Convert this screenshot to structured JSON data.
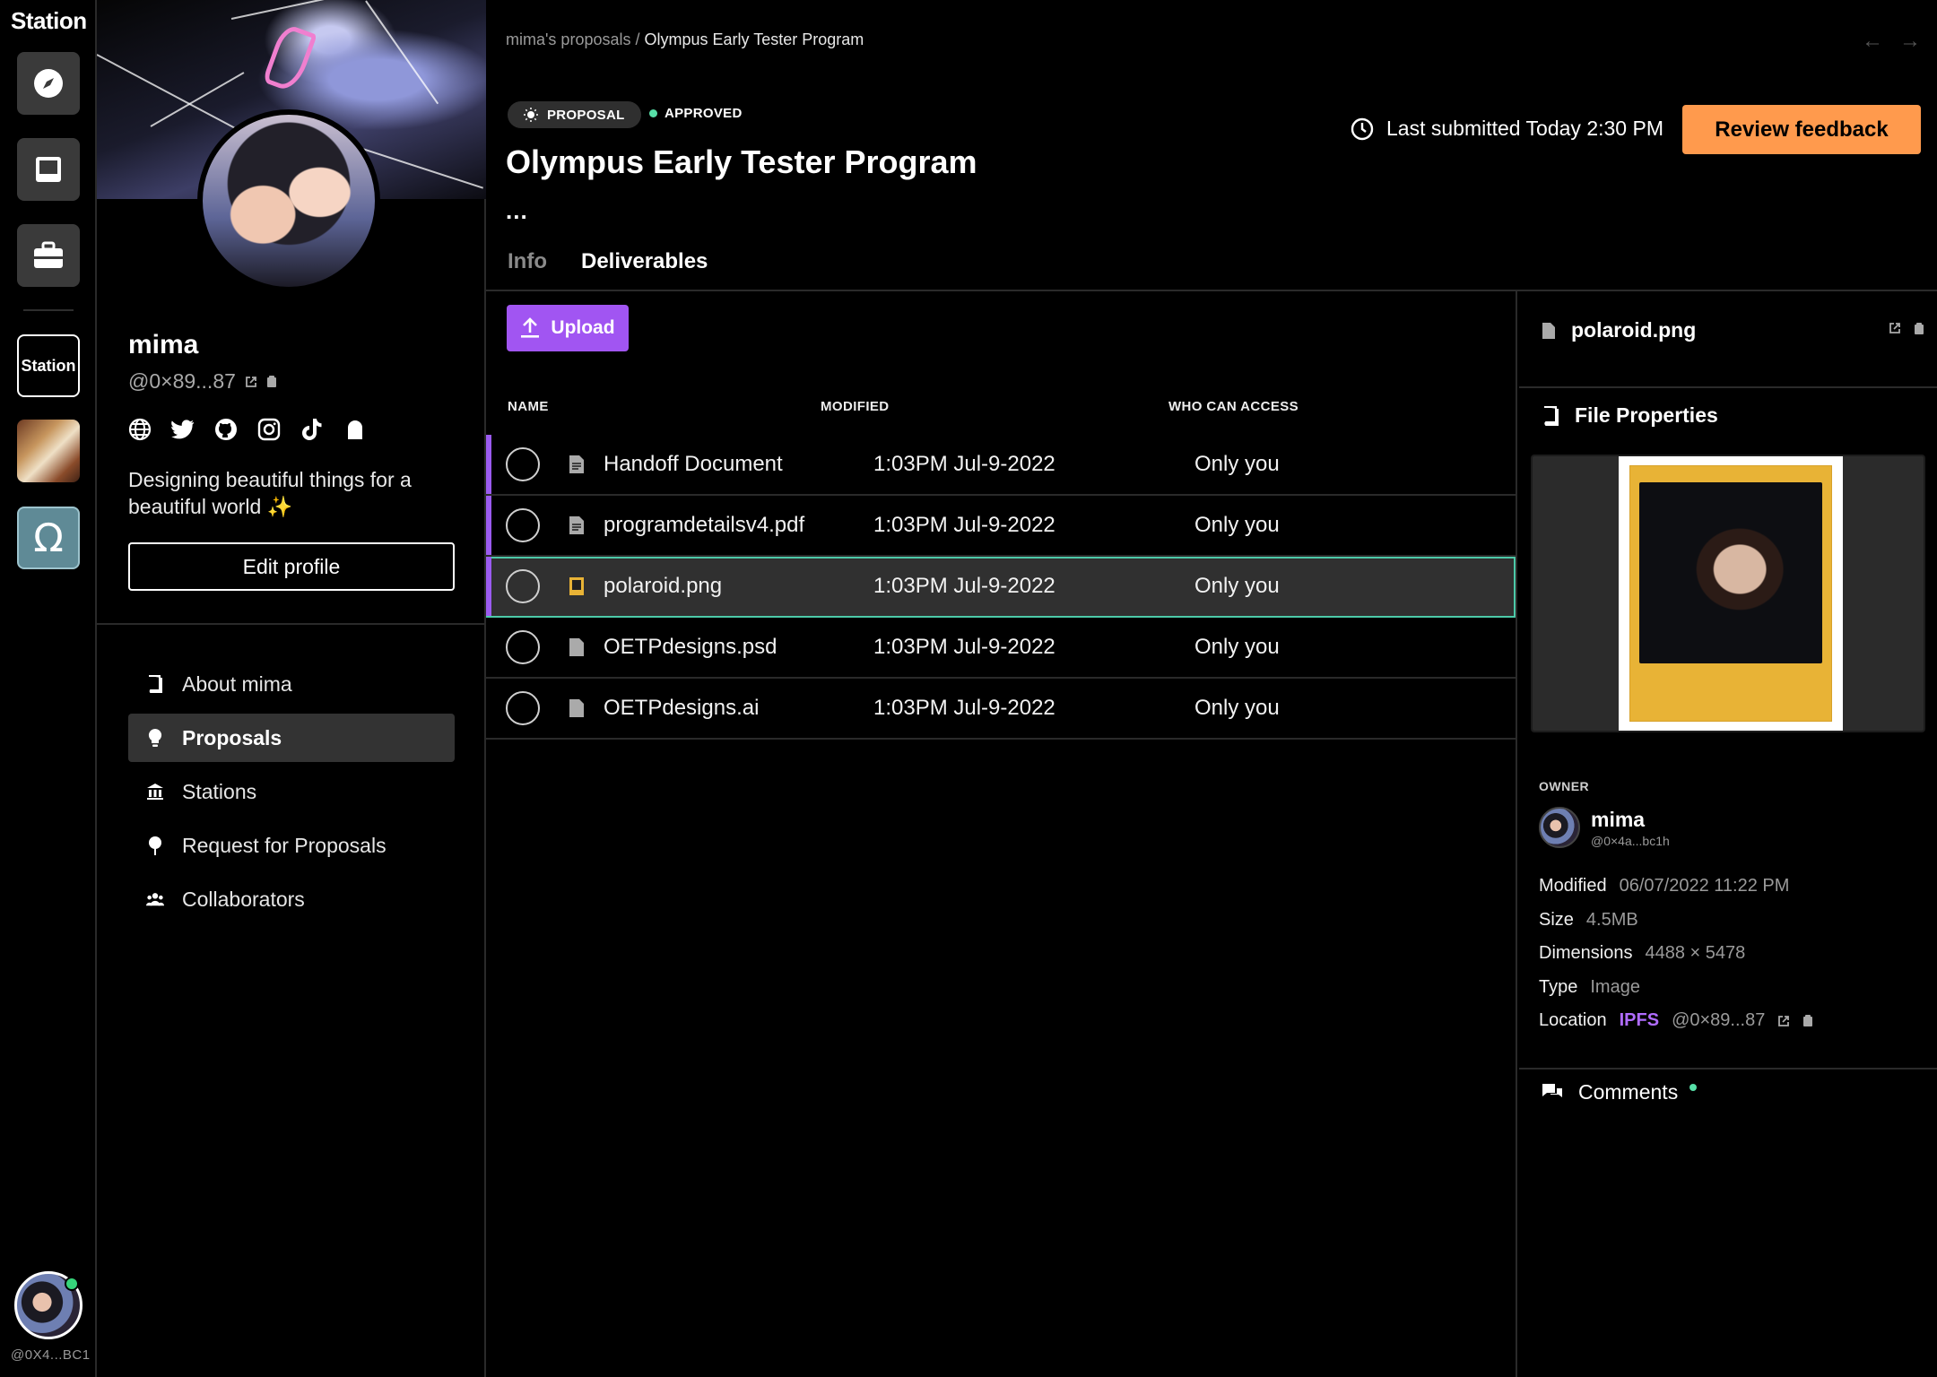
{
  "rail": {
    "title": "Station",
    "station_chip": "Station",
    "omega_glyph": "Ω",
    "user_handle": "@0X4...BC1",
    "icons": [
      "compass-icon",
      "inbox-icon",
      "briefcase-icon"
    ]
  },
  "profile": {
    "name": "mima",
    "handle": "@0×89...87",
    "bio": "Designing beautiful things for a beautiful world ✨",
    "edit_label": "Edit profile",
    "socials": [
      "globe-icon",
      "twitter-icon",
      "github-icon",
      "instagram-icon",
      "tiktok-icon",
      "ghost-icon"
    ],
    "nav": [
      {
        "label": "About mima",
        "icon": "book-icon",
        "active": false
      },
      {
        "label": "Proposals",
        "icon": "lightbulb-icon",
        "active": true
      },
      {
        "label": "Stations",
        "icon": "bank-icon",
        "active": false
      },
      {
        "label": "Request for Proposals",
        "icon": "pin-icon",
        "active": false
      },
      {
        "label": "Collaborators",
        "icon": "people-icon",
        "active": false
      }
    ]
  },
  "main": {
    "breadcrumb_parent": "mima's proposals /",
    "breadcrumb_current": "Olympus Early Tester Program",
    "tag": "PROPOSAL",
    "status": "APPROVED",
    "title": "Olympus Early Tester Program",
    "ellipsis": "...",
    "last_submitted": "Last submitted Today 2:30 PM",
    "review_label": "Review feedback",
    "tabs": [
      {
        "label": "Info",
        "active": false
      },
      {
        "label": "Deliverables",
        "active": true
      }
    ]
  },
  "files": {
    "upload_label": "Upload",
    "columns": {
      "name": "NAME",
      "modified": "MODIFIED",
      "access": "WHO CAN ACCESS"
    },
    "rows": [
      {
        "name": "Handoff Document",
        "modified": "1:03PM Jul-9-2022",
        "access": "Only you",
        "icon": "doc-icon",
        "selected": false
      },
      {
        "name": "programdetailsv4.pdf",
        "modified": "1:03PM Jul-9-2022",
        "access": "Only you",
        "icon": "doc-icon",
        "selected": false
      },
      {
        "name": "polaroid.png",
        "modified": "1:03PM Jul-9-2022",
        "access": "Only you",
        "icon": "image-icon",
        "selected": true
      },
      {
        "name": "OETPdesigns.psd",
        "modified": "1:03PM Jul-9-2022",
        "access": "Only you",
        "icon": "file-icon",
        "selected": false
      },
      {
        "name": "OETPdesigns.ai",
        "modified": "1:03PM Jul-9-2022",
        "access": "Only you",
        "icon": "file-icon",
        "selected": false
      }
    ]
  },
  "side": {
    "file_name": "polaroid.png",
    "section_title": "File Properties",
    "owner_label": "OWNER",
    "owner_name": "mima",
    "owner_handle": "@0×4a...bc1h",
    "props": {
      "modified_k": "Modified",
      "modified_v": "06/07/2022 11:22 PM",
      "size_k": "Size",
      "size_v": "4.5MB",
      "dimensions_k": "Dimensions",
      "dimensions_v": "4488 × 5478",
      "type_k": "Type",
      "type_v": "Image",
      "location_k": "Location",
      "location_ipfs": "IPFS",
      "location_v": "@0×89...87"
    },
    "comments_label": "Comments"
  },
  "colors": {
    "accent_purple": "#a155f2",
    "review_orange": "#ff9a4d",
    "approved_green": "#57e0a8",
    "selection_outline": "#4cc9a8"
  }
}
